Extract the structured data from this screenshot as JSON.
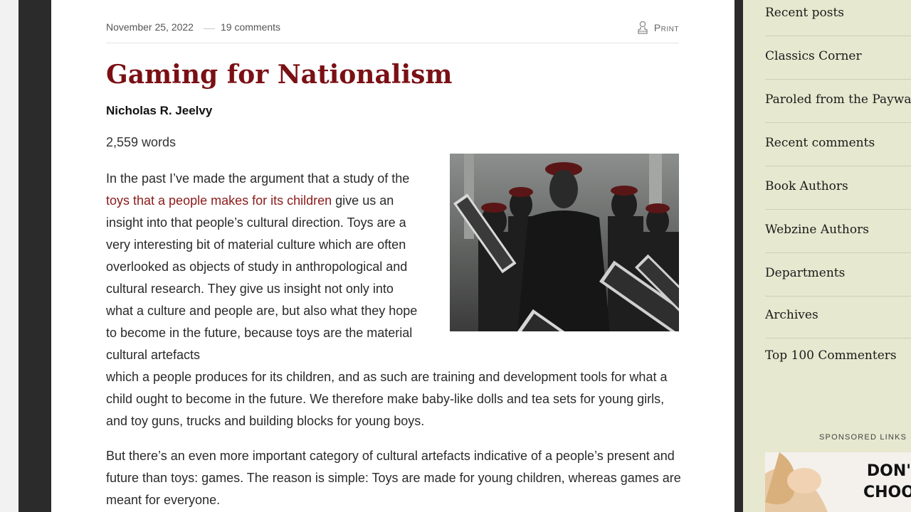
{
  "meta": {
    "date": "November 25, 2022",
    "comments": "19 comments",
    "print_label": "Print"
  },
  "article": {
    "title": "Gaming for Nationalism",
    "author": "Nicholas R. Jeelvy",
    "word_count": "2,559 words",
    "p1_start": "In the past I’ve made the argument that a study of the ",
    "p1_link": "toys that a people makes for its children",
    "p1_mid": " give us an insight into that people’s cultural direction. Toys are a very interesting bit of material culture which are often overlooked as objects of study in anthropological and cultural research. They give us insight not only into what a culture and people are, but also what they hope to become in the future, because toys are the material cultural artefacts",
    "p1_end": "which a people produces for its children, and as such are training and development tools for what a child ought to become in the future. We therefore make baby-like dolls and tea sets for young girls, and toy guns, trucks and building blocks for young boys.",
    "p2": "But there’s an even more important category of cultural artefacts indicative of a people’s present and future than toys: games. The reason is simple: Toys are made for young children, whereas games are meant for everyone."
  },
  "sidebar": {
    "items": [
      {
        "label": "Recent posts"
      },
      {
        "label": "Classics Corner"
      },
      {
        "label": "Paroled from the Paywall"
      },
      {
        "label": "Recent comments"
      },
      {
        "label": "Book Authors"
      },
      {
        "label": "Webzine Authors"
      },
      {
        "label": "Departments"
      },
      {
        "label": "Archives"
      },
      {
        "label": "Top 100 Commenters"
      }
    ],
    "sponsored_label": "SPONSORED LINKS",
    "ad_text": "DON'T CHOOS"
  },
  "icons": {
    "print": "printer-icon"
  },
  "colors": {
    "title": "#7a1015",
    "link": "#8b1a1a",
    "sidebar_bg": "#e6e8cf",
    "frame_dark": "#2b2b2b"
  }
}
